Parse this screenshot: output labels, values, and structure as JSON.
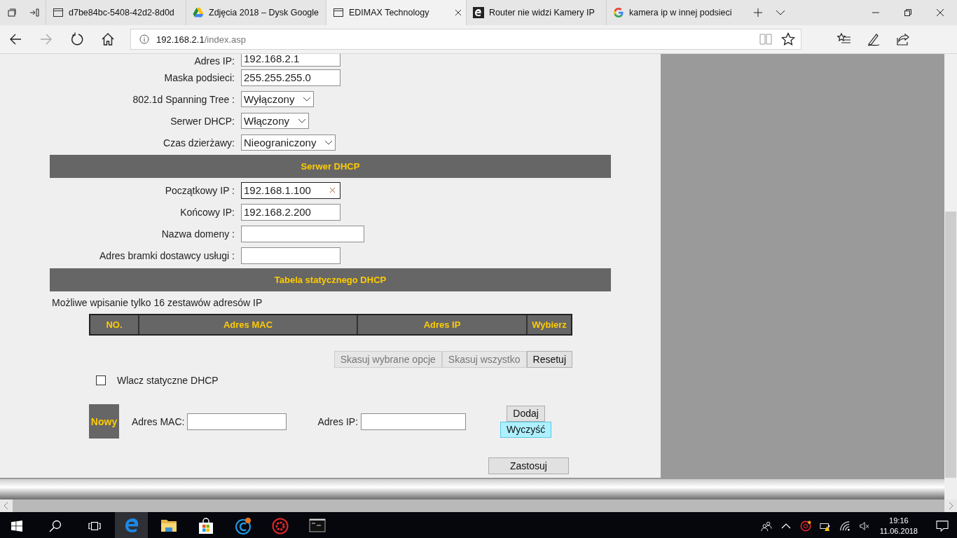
{
  "browser": {
    "tabs": [
      {
        "title": "d7be84bc-5408-42d2-8d0d",
        "selected": false
      },
      {
        "title": "Zdjęcia 2018 – Dysk Google",
        "selected": false
      },
      {
        "title": "EDIMAX Technology",
        "selected": true
      },
      {
        "title": "Router nie widzi Kamery IP",
        "selected": false
      },
      {
        "title": "kamera ip w innej podsieci",
        "selected": false
      }
    ],
    "url_host": "192.168.2.1",
    "url_path": "/index.asp",
    "forward_disabled": true
  },
  "lan_fields": [
    {
      "label": "Adres IP:",
      "kind": "text",
      "value": "192.168.2.1"
    },
    {
      "label": "Maska podsieci:",
      "kind": "text",
      "value": "255.255.255.0"
    },
    {
      "label": "802.1d Spanning Tree :",
      "kind": "select",
      "value": "Wyłączony"
    },
    {
      "label": "Serwer DHCP:",
      "kind": "select",
      "value": "Włączony"
    },
    {
      "label": "Czas dzierżawy:",
      "kind": "select",
      "value": "Nieograniczony"
    }
  ],
  "dhcp_section": {
    "title": "Serwer DHCP",
    "fields": [
      {
        "label": "Początkowy IP :",
        "value": "192.168.1.100",
        "focused": true
      },
      {
        "label": "Końcowy IP:",
        "value": "192.168.2.200",
        "focused": false
      },
      {
        "label": "Nazwa domeny :",
        "focused": false
      },
      {
        "label": "Adres bramki dostawcy usługi :",
        "focused": false
      }
    ]
  },
  "static_section": {
    "title": "Tabela statycznego DHCP",
    "note": "Możliwe wpisanie tylko 16 zestawów adresów IP",
    "columns": [
      "NO.",
      "Adres MAC",
      "Adres IP",
      "Wybierz"
    ],
    "buttons": [
      {
        "label": "Skasuj wybrane opcje",
        "disabled": true
      },
      {
        "label": "Skasuj wszystko",
        "disabled": true
      },
      {
        "label": "Resetuj",
        "disabled": false
      }
    ],
    "enable_static": {
      "label": "Wlacz statyczne DHCP",
      "checked": false
    },
    "new_entry": {
      "tag": "Nowy",
      "mac_label": "Adres MAC:",
      "ip_label": "Adres IP:",
      "add": "Dodaj",
      "clear": "Wyczyść"
    },
    "apply": "Zastosuj"
  },
  "taskbar": {
    "apps": [
      {
        "kind": "edge",
        "running": true,
        "active": true
      },
      {
        "kind": "explorer",
        "running": true,
        "active": false
      },
      {
        "kind": "store",
        "running": false,
        "active": false
      },
      {
        "kind": "ccleaner",
        "running": false,
        "active": false
      },
      {
        "kind": "gear",
        "running": false,
        "active": false
      },
      {
        "kind": "cmd",
        "running": true,
        "active": false
      }
    ],
    "time": "19:16",
    "date": "11.06.2018"
  }
}
